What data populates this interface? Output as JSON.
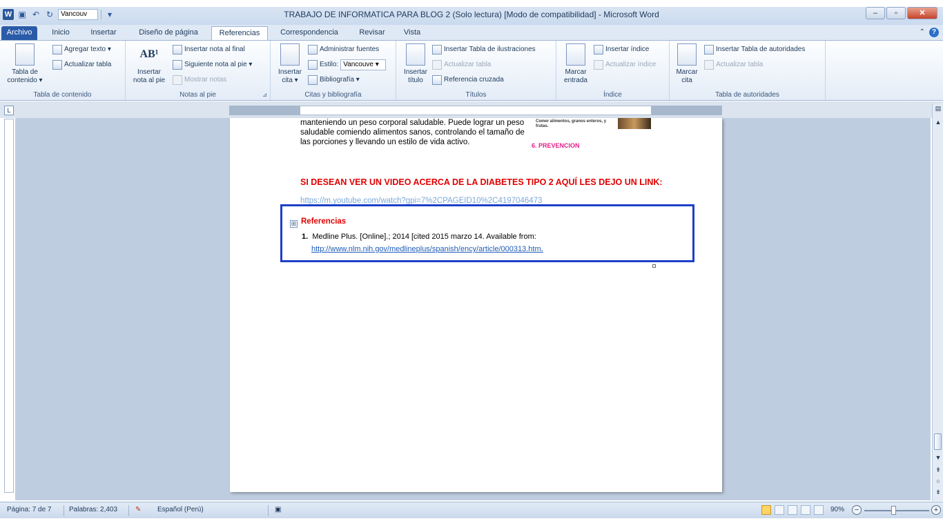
{
  "window": {
    "title": "TRABAJO DE INFORMATICA PARA BLOG 2 (Solo lectura) [Modo de compatibilidad] - Microsoft Word",
    "qat_style": "Vancouv",
    "minimize": "–",
    "maximize": "▫",
    "close": "✕"
  },
  "tabs": [
    "Archivo",
    "Inicio",
    "Insertar",
    "Diseño de página",
    "Referencias",
    "Correspondencia",
    "Revisar",
    "Vista"
  ],
  "ribbon": {
    "toc": {
      "group_label": "Tabla de contenido",
      "big_label": "Tabla de\ncontenido ▾",
      "add_text": "Agregar texto ▾",
      "update_table": "Actualizar tabla"
    },
    "footnotes": {
      "group_label": "Notas al pie",
      "big_label": "Insertar\nnota al pie",
      "big_icon": "AB¹",
      "insert_endnote": "Insertar nota al final",
      "next_footnote": "Siguiente nota al pie ▾",
      "show_notes": "Mostrar notas"
    },
    "citations": {
      "group_label": "Citas y bibliografía",
      "big_label": "Insertar\ncita ▾",
      "manage_sources": "Administrar fuentes",
      "style_label": "Estilo:",
      "style_value": "Vancouve ▾",
      "bibliography": "Bibliografía ▾"
    },
    "captions": {
      "group_label": "Títulos",
      "big_label": "Insertar\ntítulo",
      "insert_table_figures": "Insertar Tabla de ilustraciones",
      "update_table": "Actualizar tabla",
      "cross_reference": "Referencia cruzada"
    },
    "index": {
      "group_label": "Índice",
      "big_label": "Marcar\nentrada",
      "insert_index": "Insertar índice",
      "update_index": "Actualizar índice"
    },
    "authorities": {
      "group_label": "Tabla de autoridades",
      "big_label": "Marcar\ncita",
      "insert_table": "Insertar Tabla de autoridades",
      "update_table": "Actualizar tabla"
    }
  },
  "document": {
    "paragraph": "manteniendo un peso corporal saludable. Puede lograr un peso saludable comiendo alimentos sanos, controlando el tamaño de las porciones y llevando un estilo de vida activo.",
    "side_caption": "Comer alimentos, granos enteros, y frutas.",
    "prevencion": "6. PREVENCION",
    "video_line": "SI DESEAN VER UN VIDEO ACERCA DE LA DIABETES TIPO 2 AQUÍ LES DEJO UN LINK:",
    "video_url": "https://m.youtube.com/watch?gpi=7%2CPAGEID10%2C4197046473",
    "references_title": "Referencias",
    "ref_number": "1.",
    "ref_text": "Medline Plus. [Online].; 2014 [cited 2015 marzo 14. Available from:",
    "ref_url": "http://www.nlm.nih.gov/medlineplus/spanish/ency/article/000313.htm",
    "ref_url_trailing": "."
  },
  "status": {
    "page": "Página: 7 de 7",
    "words": "Palabras: 2,403",
    "language": "Español (Perú)",
    "zoom": "90%"
  }
}
